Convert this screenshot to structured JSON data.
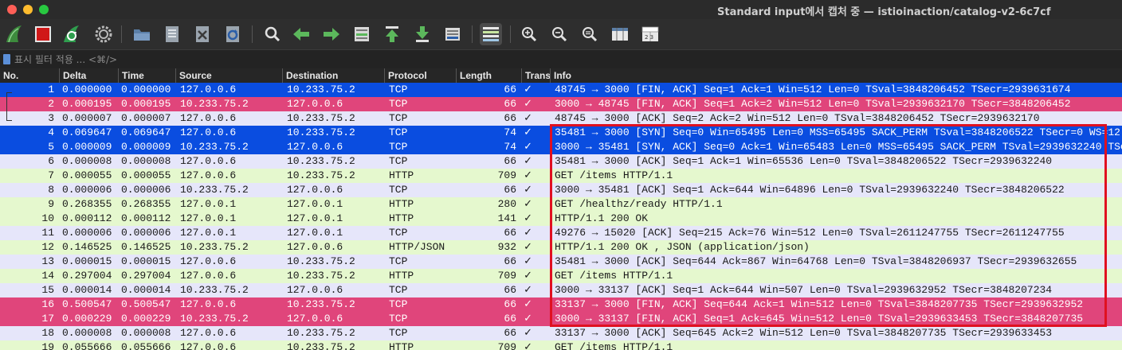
{
  "window": {
    "title": "Standard input에서 캡처 중 — istioinaction/catalog-v2-6c7cf"
  },
  "toolbar": {
    "icons": [
      "shark-fin-start-icon",
      "stop-capture-icon",
      "restart-capture-icon",
      "capture-options-gear-icon",
      "open-folder-icon",
      "save-file-icon",
      "close-file-icon",
      "reload-file-icon",
      "find-packet-icon",
      "go-back-icon",
      "go-forward-icon",
      "go-to-packet-icon",
      "first-packet-icon",
      "last-packet-icon",
      "auto-scroll-icon",
      "colorize-icon",
      "zoom-in-icon",
      "zoom-out-icon",
      "normal-size-icon",
      "resize-columns-icon",
      "layout-icon"
    ]
  },
  "filter": {
    "placeholder": "표시 필터 적용 ... <⌘/>"
  },
  "columns": [
    "No.",
    "Delta",
    "Time",
    "Source",
    "Destination",
    "Protocol",
    "Length",
    "Trans",
    "Info"
  ],
  "colors": {
    "blue_row": "#0a4de0",
    "pink_row": "#e0457b",
    "lavender_row": "#e6e6fa",
    "green_row": "#e5f8ce",
    "highlight_box": "#e01020"
  },
  "packets": [
    {
      "no": "1",
      "delta": "0.000000",
      "time": "0.000000",
      "src": "127.0.0.6",
      "dst": "10.233.75.2",
      "proto": "TCP",
      "len": "66",
      "trans": "✓",
      "info": "48745 → 3000 [FIN, ACK] Seq=1 Ack=1 Win=512 Len=0 TSval=3848206452 TSecr=2939631674",
      "style": "blue"
    },
    {
      "no": "2",
      "delta": "0.000195",
      "time": "0.000195",
      "src": "10.233.75.2",
      "dst": "127.0.0.6",
      "proto": "TCP",
      "len": "66",
      "trans": "✓",
      "info": "3000 → 48745 [FIN, ACK] Seq=1 Ack=2 Win=512 Len=0 TSval=2939632170 TSecr=3848206452",
      "style": "pink"
    },
    {
      "no": "3",
      "delta": "0.000007",
      "time": "0.000007",
      "src": "127.0.0.6",
      "dst": "10.233.75.2",
      "proto": "TCP",
      "len": "66",
      "trans": "✓",
      "info": "48745 → 3000 [ACK] Seq=2 Ack=2 Win=512 Len=0 TSval=3848206452 TSecr=2939632170",
      "style": "lavender"
    },
    {
      "no": "4",
      "delta": "0.069647",
      "time": "0.069647",
      "src": "127.0.0.6",
      "dst": "10.233.75.2",
      "proto": "TCP",
      "len": "74",
      "trans": "✓",
      "info": "35481 → 3000 [SYN] Seq=0 Win=65495 Len=0 MSS=65495 SACK_PERM TSval=3848206522 TSecr=0 WS=12",
      "style": "blue"
    },
    {
      "no": "5",
      "delta": "0.000009",
      "time": "0.000009",
      "src": "10.233.75.2",
      "dst": "127.0.0.6",
      "proto": "TCP",
      "len": "74",
      "trans": "✓",
      "info": "3000 → 35481 [SYN, ACK] Seq=0 Ack=1 Win=65483 Len=0 MSS=65495 SACK_PERM TSval=2939632240 TSe",
      "style": "blue"
    },
    {
      "no": "6",
      "delta": "0.000008",
      "time": "0.000008",
      "src": "127.0.0.6",
      "dst": "10.233.75.2",
      "proto": "TCP",
      "len": "66",
      "trans": "✓",
      "info": "35481 → 3000 [ACK] Seq=1 Ack=1 Win=65536 Len=0 TSval=3848206522 TSecr=2939632240",
      "style": "lavender"
    },
    {
      "no": "7",
      "delta": "0.000055",
      "time": "0.000055",
      "src": "127.0.0.6",
      "dst": "10.233.75.2",
      "proto": "HTTP",
      "len": "709",
      "trans": "✓",
      "info": "GET /items HTTP/1.1",
      "style": "green"
    },
    {
      "no": "8",
      "delta": "0.000006",
      "time": "0.000006",
      "src": "10.233.75.2",
      "dst": "127.0.0.6",
      "proto": "TCP",
      "len": "66",
      "trans": "✓",
      "info": "3000 → 35481 [ACK] Seq=1 Ack=644 Win=64896 Len=0 TSval=2939632240 TSecr=3848206522",
      "style": "lavender"
    },
    {
      "no": "9",
      "delta": "0.268355",
      "time": "0.268355",
      "src": "127.0.0.1",
      "dst": "127.0.0.1",
      "proto": "HTTP",
      "len": "280",
      "trans": "✓",
      "info": "GET /healthz/ready HTTP/1.1",
      "style": "green"
    },
    {
      "no": "10",
      "delta": "0.000112",
      "time": "0.000112",
      "src": "127.0.0.1",
      "dst": "127.0.0.1",
      "proto": "HTTP",
      "len": "141",
      "trans": "✓",
      "info": "HTTP/1.1 200 OK",
      "style": "green"
    },
    {
      "no": "11",
      "delta": "0.000006",
      "time": "0.000006",
      "src": "127.0.0.1",
      "dst": "127.0.0.1",
      "proto": "TCP",
      "len": "66",
      "trans": "✓",
      "info": "49276 → 15020 [ACK] Seq=215 Ack=76 Win=512 Len=0 TSval=2611247755 TSecr=2611247755",
      "style": "lavender"
    },
    {
      "no": "12",
      "delta": "0.146525",
      "time": "0.146525",
      "src": "10.233.75.2",
      "dst": "127.0.0.6",
      "proto": "HTTP/JSON",
      "len": "932",
      "trans": "✓",
      "info": "HTTP/1.1 200 OK , JSON (application/json)",
      "style": "green"
    },
    {
      "no": "13",
      "delta": "0.000015",
      "time": "0.000015",
      "src": "127.0.0.6",
      "dst": "10.233.75.2",
      "proto": "TCP",
      "len": "66",
      "trans": "✓",
      "info": "35481 → 3000 [ACK] Seq=644 Ack=867 Win=64768 Len=0 TSval=3848206937 TSecr=2939632655",
      "style": "lavender"
    },
    {
      "no": "14",
      "delta": "0.297004",
      "time": "0.297004",
      "src": "127.0.0.6",
      "dst": "10.233.75.2",
      "proto": "HTTP",
      "len": "709",
      "trans": "✓",
      "info": "GET /items HTTP/1.1",
      "style": "green"
    },
    {
      "no": "15",
      "delta": "0.000014",
      "time": "0.000014",
      "src": "10.233.75.2",
      "dst": "127.0.0.6",
      "proto": "TCP",
      "len": "66",
      "trans": "✓",
      "info": "3000 → 33137 [ACK] Seq=1 Ack=644 Win=507 Len=0 TSval=2939632952 TSecr=3848207234",
      "style": "lavender"
    },
    {
      "no": "16",
      "delta": "0.500547",
      "time": "0.500547",
      "src": "127.0.0.6",
      "dst": "10.233.75.2",
      "proto": "TCP",
      "len": "66",
      "trans": "✓",
      "info": "33137 → 3000 [FIN, ACK] Seq=644 Ack=1 Win=512 Len=0 TSval=3848207735 TSecr=2939632952",
      "style": "pink"
    },
    {
      "no": "17",
      "delta": "0.000229",
      "time": "0.000229",
      "src": "10.233.75.2",
      "dst": "127.0.0.6",
      "proto": "TCP",
      "len": "66",
      "trans": "✓",
      "info": "3000 → 33137 [FIN, ACK] Seq=1 Ack=645 Win=512 Len=0 TSval=2939633453 TSecr=3848207735",
      "style": "pink"
    },
    {
      "no": "18",
      "delta": "0.000008",
      "time": "0.000008",
      "src": "127.0.0.6",
      "dst": "10.233.75.2",
      "proto": "TCP",
      "len": "66",
      "trans": "✓",
      "info": "33137 → 3000 [ACK] Seq=645 Ack=2 Win=512 Len=0 TSval=3848207735 TSecr=2939633453",
      "style": "lavender"
    },
    {
      "no": "19",
      "delta": "0.055666",
      "time": "0.055666",
      "src": "127.0.0.6",
      "dst": "10.233.75.2",
      "proto": "HTTP",
      "len": "709",
      "trans": "✓",
      "info": "GET /items HTTP/1.1",
      "style": "green"
    }
  ]
}
